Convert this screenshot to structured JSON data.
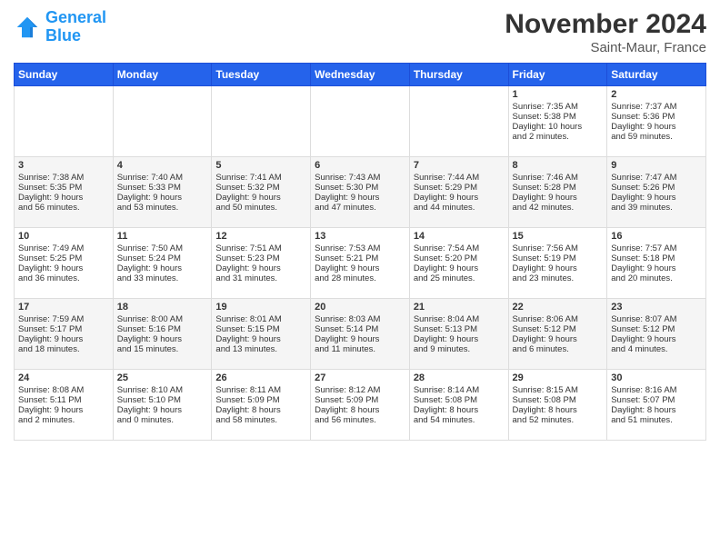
{
  "logo": {
    "line1": "General",
    "line2": "Blue"
  },
  "title": "November 2024",
  "location": "Saint-Maur, France",
  "days_of_week": [
    "Sunday",
    "Monday",
    "Tuesday",
    "Wednesday",
    "Thursday",
    "Friday",
    "Saturday"
  ],
  "weeks": [
    [
      {
        "day": "",
        "content": ""
      },
      {
        "day": "",
        "content": ""
      },
      {
        "day": "",
        "content": ""
      },
      {
        "day": "",
        "content": ""
      },
      {
        "day": "",
        "content": ""
      },
      {
        "day": "1",
        "content": "Sunrise: 7:35 AM\nSunset: 5:38 PM\nDaylight: 10 hours\nand 2 minutes."
      },
      {
        "day": "2",
        "content": "Sunrise: 7:37 AM\nSunset: 5:36 PM\nDaylight: 9 hours\nand 59 minutes."
      }
    ],
    [
      {
        "day": "3",
        "content": "Sunrise: 7:38 AM\nSunset: 5:35 PM\nDaylight: 9 hours\nand 56 minutes."
      },
      {
        "day": "4",
        "content": "Sunrise: 7:40 AM\nSunset: 5:33 PM\nDaylight: 9 hours\nand 53 minutes."
      },
      {
        "day": "5",
        "content": "Sunrise: 7:41 AM\nSunset: 5:32 PM\nDaylight: 9 hours\nand 50 minutes."
      },
      {
        "day": "6",
        "content": "Sunrise: 7:43 AM\nSunset: 5:30 PM\nDaylight: 9 hours\nand 47 minutes."
      },
      {
        "day": "7",
        "content": "Sunrise: 7:44 AM\nSunset: 5:29 PM\nDaylight: 9 hours\nand 44 minutes."
      },
      {
        "day": "8",
        "content": "Sunrise: 7:46 AM\nSunset: 5:28 PM\nDaylight: 9 hours\nand 42 minutes."
      },
      {
        "day": "9",
        "content": "Sunrise: 7:47 AM\nSunset: 5:26 PM\nDaylight: 9 hours\nand 39 minutes."
      }
    ],
    [
      {
        "day": "10",
        "content": "Sunrise: 7:49 AM\nSunset: 5:25 PM\nDaylight: 9 hours\nand 36 minutes."
      },
      {
        "day": "11",
        "content": "Sunrise: 7:50 AM\nSunset: 5:24 PM\nDaylight: 9 hours\nand 33 minutes."
      },
      {
        "day": "12",
        "content": "Sunrise: 7:51 AM\nSunset: 5:23 PM\nDaylight: 9 hours\nand 31 minutes."
      },
      {
        "day": "13",
        "content": "Sunrise: 7:53 AM\nSunset: 5:21 PM\nDaylight: 9 hours\nand 28 minutes."
      },
      {
        "day": "14",
        "content": "Sunrise: 7:54 AM\nSunset: 5:20 PM\nDaylight: 9 hours\nand 25 minutes."
      },
      {
        "day": "15",
        "content": "Sunrise: 7:56 AM\nSunset: 5:19 PM\nDaylight: 9 hours\nand 23 minutes."
      },
      {
        "day": "16",
        "content": "Sunrise: 7:57 AM\nSunset: 5:18 PM\nDaylight: 9 hours\nand 20 minutes."
      }
    ],
    [
      {
        "day": "17",
        "content": "Sunrise: 7:59 AM\nSunset: 5:17 PM\nDaylight: 9 hours\nand 18 minutes."
      },
      {
        "day": "18",
        "content": "Sunrise: 8:00 AM\nSunset: 5:16 PM\nDaylight: 9 hours\nand 15 minutes."
      },
      {
        "day": "19",
        "content": "Sunrise: 8:01 AM\nSunset: 5:15 PM\nDaylight: 9 hours\nand 13 minutes."
      },
      {
        "day": "20",
        "content": "Sunrise: 8:03 AM\nSunset: 5:14 PM\nDaylight: 9 hours\nand 11 minutes."
      },
      {
        "day": "21",
        "content": "Sunrise: 8:04 AM\nSunset: 5:13 PM\nDaylight: 9 hours\nand 9 minutes."
      },
      {
        "day": "22",
        "content": "Sunrise: 8:06 AM\nSunset: 5:12 PM\nDaylight: 9 hours\nand 6 minutes."
      },
      {
        "day": "23",
        "content": "Sunrise: 8:07 AM\nSunset: 5:12 PM\nDaylight: 9 hours\nand 4 minutes."
      }
    ],
    [
      {
        "day": "24",
        "content": "Sunrise: 8:08 AM\nSunset: 5:11 PM\nDaylight: 9 hours\nand 2 minutes."
      },
      {
        "day": "25",
        "content": "Sunrise: 8:10 AM\nSunset: 5:10 PM\nDaylight: 9 hours\nand 0 minutes."
      },
      {
        "day": "26",
        "content": "Sunrise: 8:11 AM\nSunset: 5:09 PM\nDaylight: 8 hours\nand 58 minutes."
      },
      {
        "day": "27",
        "content": "Sunrise: 8:12 AM\nSunset: 5:09 PM\nDaylight: 8 hours\nand 56 minutes."
      },
      {
        "day": "28",
        "content": "Sunrise: 8:14 AM\nSunset: 5:08 PM\nDaylight: 8 hours\nand 54 minutes."
      },
      {
        "day": "29",
        "content": "Sunrise: 8:15 AM\nSunset: 5:08 PM\nDaylight: 8 hours\nand 52 minutes."
      },
      {
        "day": "30",
        "content": "Sunrise: 8:16 AM\nSunset: 5:07 PM\nDaylight: 8 hours\nand 51 minutes."
      }
    ]
  ]
}
